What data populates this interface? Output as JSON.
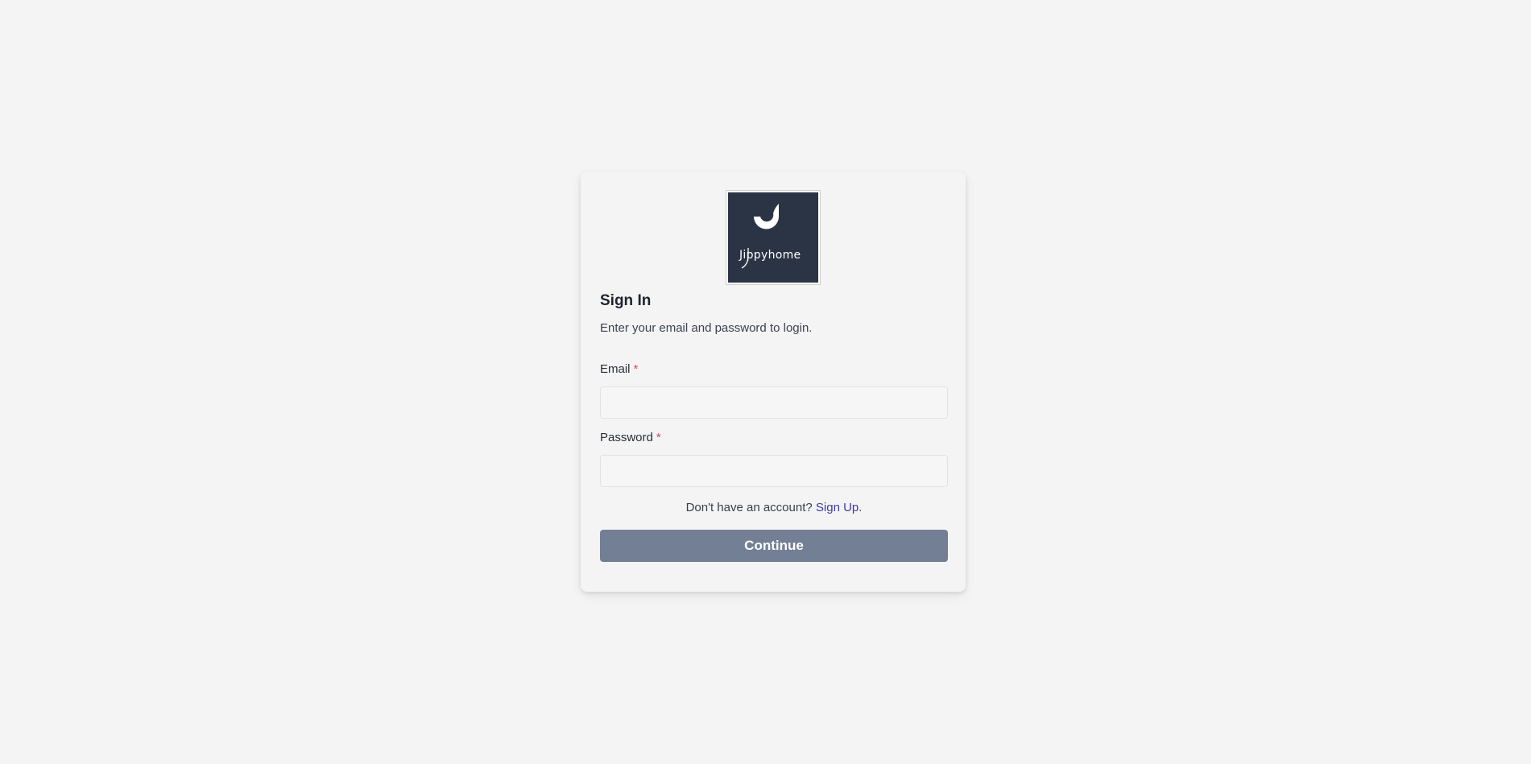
{
  "logo": {
    "wordmark": "Jippyhome",
    "icon": "jippyhome-logo-icon",
    "background_color": "#2b3445"
  },
  "form": {
    "title": "Sign In",
    "subtitle": "Enter your email and password to login.",
    "email": {
      "label": "Email",
      "required_marker": "*",
      "value": "",
      "placeholder": ""
    },
    "password": {
      "label": "Password",
      "required_marker": "*",
      "value": "",
      "placeholder": ""
    },
    "signup_prompt": "Don't have an account?",
    "signup_link": "Sign Up",
    "signup_suffix": ".",
    "submit_label": "Continue"
  },
  "colors": {
    "page_background": "#f4f4f4",
    "button": "#737f94",
    "link": "#3d3aa8",
    "required": "#e0455b"
  }
}
